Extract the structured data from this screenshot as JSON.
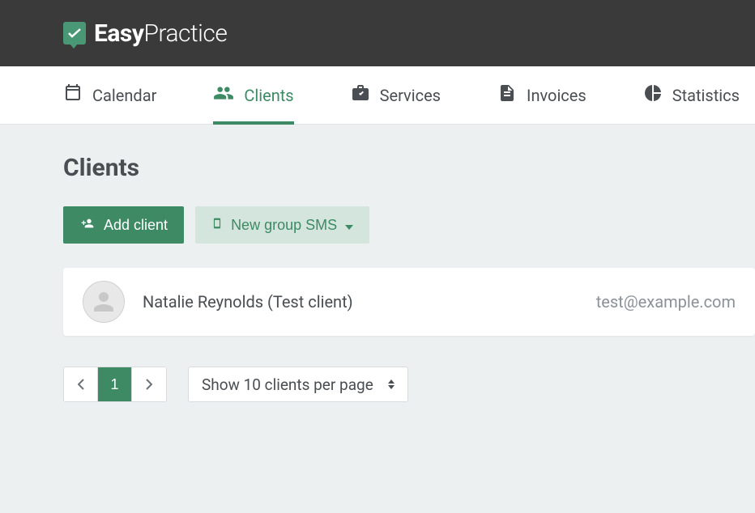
{
  "brand": {
    "name_bold": "Easy",
    "name_light": "Practice"
  },
  "nav": {
    "items": [
      {
        "label": "Calendar",
        "icon": "calendar"
      },
      {
        "label": "Clients",
        "icon": "people",
        "active": true
      },
      {
        "label": "Services",
        "icon": "briefcase"
      },
      {
        "label": "Invoices",
        "icon": "document"
      },
      {
        "label": "Statistics",
        "icon": "piechart"
      }
    ]
  },
  "page": {
    "title": "Clients"
  },
  "actions": {
    "add_client": "Add client",
    "new_group_sms": "New group SMS"
  },
  "clients": [
    {
      "name": "Natalie Reynolds (Test client)",
      "email": "test@example.com"
    }
  ],
  "pagination": {
    "current": "1"
  },
  "per_page": {
    "label": "Show 10 clients per page"
  }
}
